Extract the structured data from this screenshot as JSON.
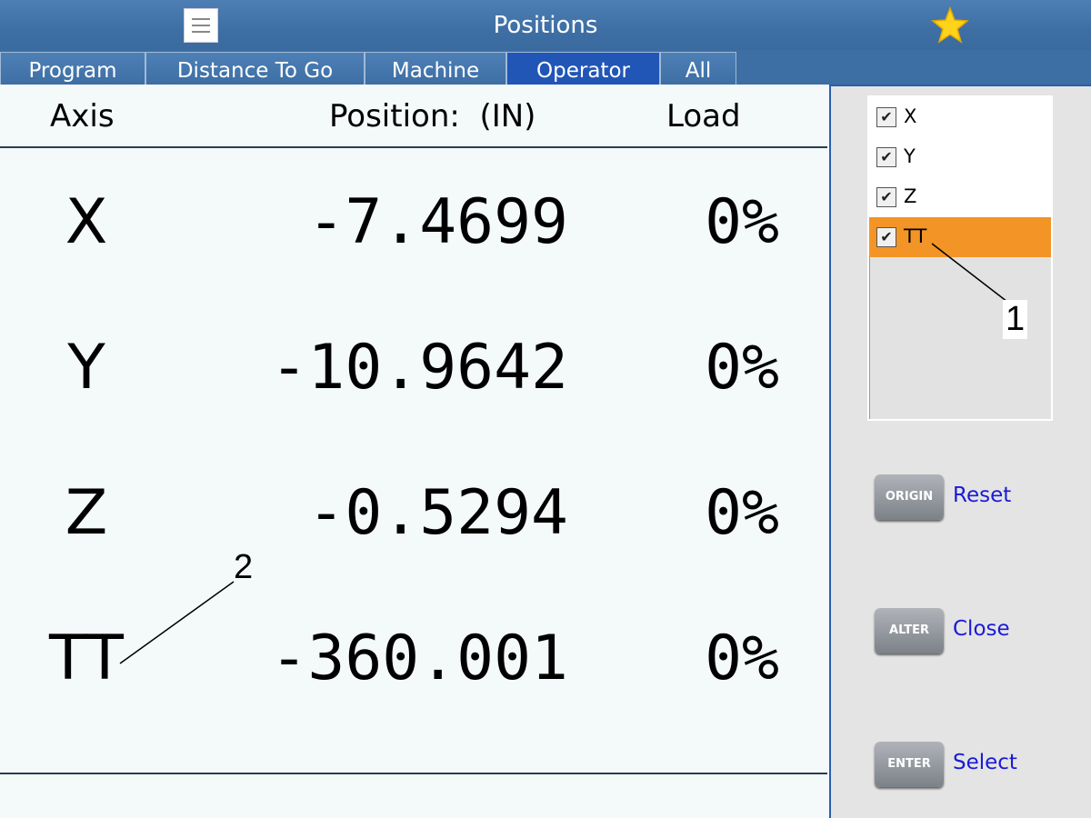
{
  "window": {
    "title": "Positions"
  },
  "tabs": [
    {
      "label": "Program"
    },
    {
      "label": "Distance To Go"
    },
    {
      "label": "Machine"
    },
    {
      "label": "Operator"
    },
    {
      "label": "All"
    }
  ],
  "active_tab": "Operator",
  "table": {
    "headers": {
      "axis": "Axis",
      "position": "Position:  (IN)",
      "load": "Load"
    },
    "rows": [
      {
        "axis": "X",
        "position": "-7.4699",
        "load": "0%"
      },
      {
        "axis": "Y",
        "position": "-10.9642",
        "load": "0%"
      },
      {
        "axis": "Z",
        "position": "-0.5294",
        "load": "0%"
      },
      {
        "axis": "TT",
        "position": "-360.001",
        "load": "0%"
      }
    ]
  },
  "axis_list": {
    "items": [
      {
        "label": "X",
        "checked": true
      },
      {
        "label": "Y",
        "checked": true
      },
      {
        "label": "Z",
        "checked": true
      },
      {
        "label": "TT",
        "checked": true
      }
    ],
    "selected": "TT",
    "check_glyph": "✔"
  },
  "keys": [
    {
      "key": "ORIGIN",
      "action": "Reset"
    },
    {
      "key": "ALTER",
      "action": "Close"
    },
    {
      "key": "ENTER",
      "action": "Select"
    }
  ],
  "callouts": [
    "1",
    "2"
  ],
  "colors": {
    "accent": "#3d6ea4",
    "active_tab": "#2156b6",
    "selected_item": "#f39526",
    "link": "#1a1ad6"
  }
}
